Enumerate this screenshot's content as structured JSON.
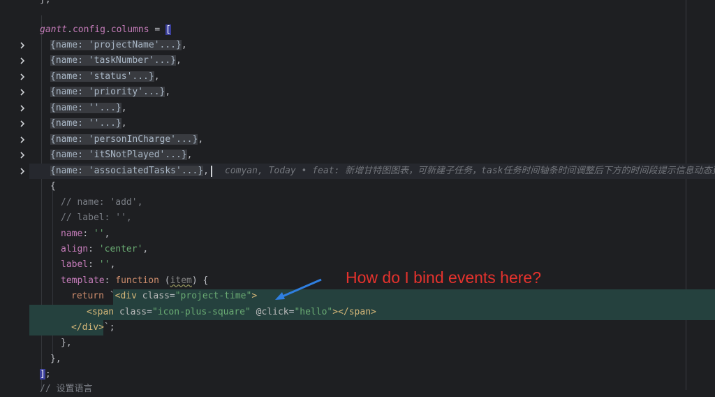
{
  "editor": {
    "line_top": "};",
    "columns_decl": {
      "obj": "gantt",
      "dot1": ".",
      "p1": "config",
      "dot2": ".",
      "p2": "columns",
      "eq": " = ",
      "bracket": "["
    },
    "folded_items": [
      {
        "text": "{name: 'projectName'...}",
        "suffix": ","
      },
      {
        "text": "{name: 'taskNumber'...}",
        "suffix": ","
      },
      {
        "text": "{name: 'status'...}",
        "suffix": ","
      },
      {
        "text": "{name: 'priority'...}",
        "suffix": ","
      },
      {
        "text": "{name: ''...}",
        "suffix": ","
      },
      {
        "text": "{name: ''...}",
        "suffix": ","
      },
      {
        "text": "{name: 'personInCharge'...}",
        "suffix": ","
      },
      {
        "text": "{name: 'itSNotPlayed'...}",
        "suffix": ","
      },
      {
        "text": "{name: 'associatedTasks'...}",
        "suffix": ","
      }
    ],
    "blame": "comyan, Today • feat: 新增甘特图图表，可新建子任务，task任务时间轴条时间调整后下方的时间段提示信息动态更新",
    "open_brace": "{",
    "comment_name": "// name: 'add',",
    "comment_label": "// label: '',",
    "name_key": "name",
    "name_val": "''",
    "align_key": "align",
    "align_val": "'center'",
    "label_key": "label",
    "label_val": "''",
    "template_key": "template",
    "function_kw": "function",
    "param": "item",
    "template_rest": ") {",
    "return_kw": "return",
    "div_open": "<div",
    "class_attr": "class",
    "div_class_val": "\"project-time\"",
    "span_open": "<span",
    "span_class_val": "\"icon-plus-square\"",
    "click_attr": "@click",
    "click_val": "\"hello\"",
    "span_close": "></span>",
    "div_close": "</div>",
    "close1": "},",
    "close2": "},",
    "close_bracket": "]",
    "semicolon": ";",
    "bottom_comment": "// 设置语言"
  },
  "annotation": {
    "text": "How do I bind events here?",
    "color": "#e5322d"
  },
  "colors": {
    "background": "#1e1f22",
    "highlight_block": "#25413e",
    "keyword": "#cf8e6d",
    "string": "#6aab73",
    "property": "#c77dbb",
    "comment": "#7a7e85",
    "tag": "#d5b778"
  },
  "icons": [
    "chevron-right-icon",
    "arrow-icon"
  ]
}
